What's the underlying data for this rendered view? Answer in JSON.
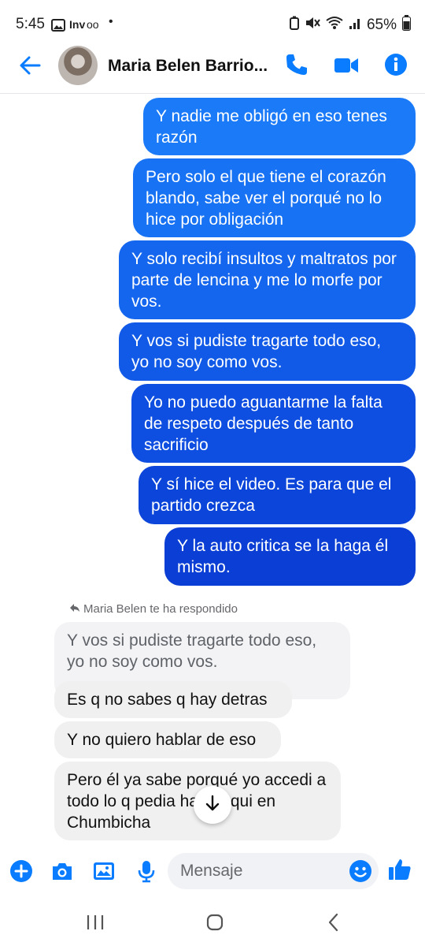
{
  "status_bar": {
    "time": "5:45",
    "carrier_text": "Inv",
    "voicemail_glyph": "oo",
    "notification_dot": "•",
    "battery": "65%"
  },
  "header": {
    "contact_name": "Maria Belen Barrio...",
    "icons": [
      "back-arrow-icon",
      "phone-icon",
      "video-camera-icon",
      "info-icon"
    ]
  },
  "messages": {
    "outgoing": [
      "Y nadie me obligó en eso tenes razón",
      "Pero solo el que tiene el corazón blando, sabe ver el porqué no lo hice por obligación",
      "Y solo recibí insultos y maltratos por parte de lencina y me lo morfe por vos.",
      "Y vos si pudiste tragarte todo eso, yo no soy como vos.",
      "Yo no puedo aguantarme la falta de respeto después de tanto sacrificio",
      "Y sí hice el video. Es para que el partido crezca",
      "Y la auto critica se la haga él mismo."
    ],
    "reply_label": "Maria Belen te ha respondido",
    "quoted": "Y vos si pudiste tragarte todo eso, yo no soy como vos.",
    "incoming": [
      "Es q no sabes q hay detras",
      "Y no quiero hablar de eso",
      "Pero él ya sabe porqué yo accedi a todo lo q pedia haga aqui en Chumbicha"
    ]
  },
  "composer": {
    "placeholder": "Mensaje",
    "icons": [
      "plus-icon",
      "camera-icon",
      "gallery-icon",
      "microphone-icon",
      "emoji-icon",
      "thumbs-up-icon"
    ]
  },
  "colors": {
    "accent": "#0a7cff",
    "bubble_top": "#1477f8",
    "bubble_bottom": "#0b3bd4",
    "incoming_bubble": "#f0f0f0"
  }
}
